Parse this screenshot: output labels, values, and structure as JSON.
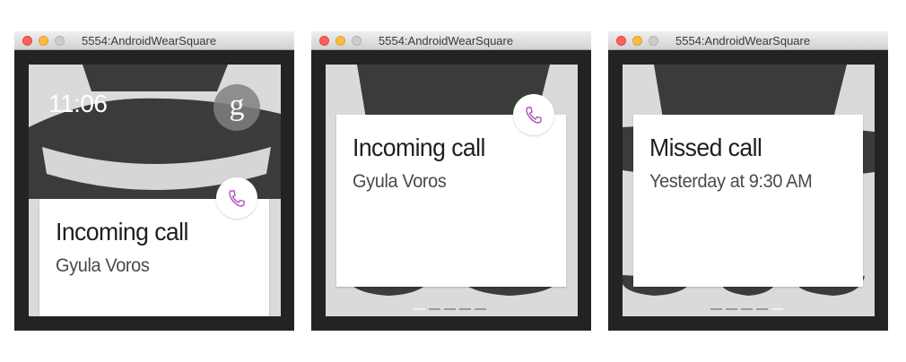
{
  "windows": [
    {
      "title": "5554:AndroidWearSquare",
      "watch": {
        "time": "11:06",
        "google_badge": "g"
      },
      "card": {
        "title": "Incoming call",
        "subtitle": "Gyula Voros",
        "icon": "phone-icon"
      }
    },
    {
      "title": "5554:AndroidWearSquare",
      "card": {
        "title": "Incoming call",
        "subtitle": "Gyula Voros",
        "icon": "phone-icon"
      },
      "pager": {
        "pages": 5,
        "active_page": 1
      }
    },
    {
      "title": "5554:AndroidWearSquare",
      "card": {
        "title": "Missed call",
        "subtitle": "Yesterday at 9:30 AM"
      },
      "pager": {
        "pages": 5,
        "active_page": 5
      }
    }
  ],
  "colors": {
    "watch_background": "#dbdada",
    "hat": "#3b3b3b",
    "phone_icon_stroke": "#b24fc0",
    "bezel": "#232323"
  }
}
